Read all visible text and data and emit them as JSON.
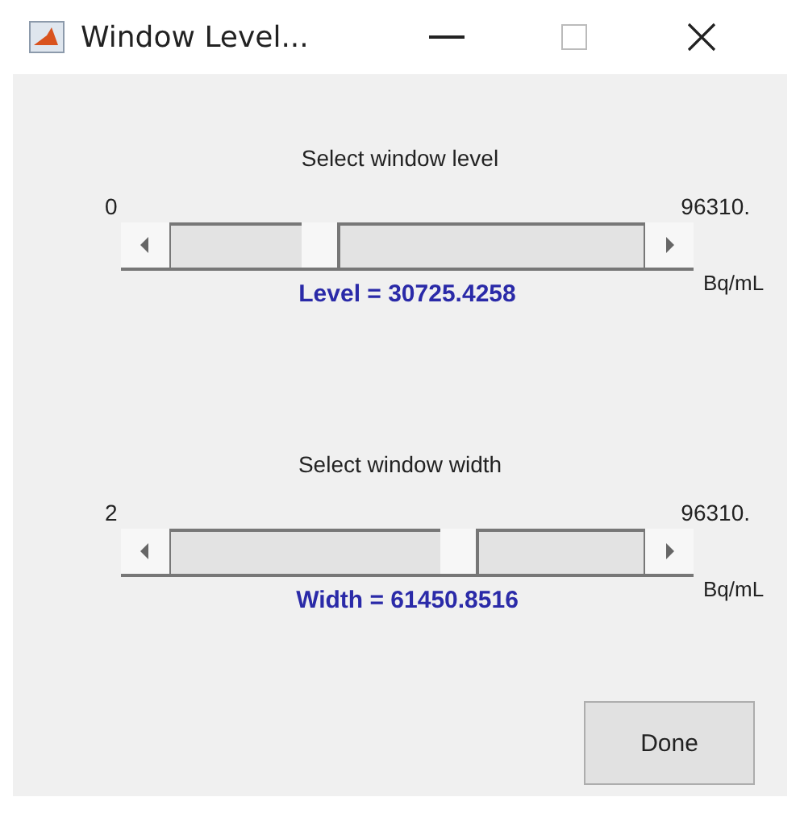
{
  "window": {
    "title": "Window Level..."
  },
  "sliders": [
    {
      "title": "Select window level",
      "min": "0",
      "max": "96310.",
      "level": 0.3,
      "reading": "Level = 30725.4258",
      "unit": "Bq/mL"
    },
    {
      "title": "Select window width",
      "min": "2",
      "max": "96310.",
      "level": 0.62,
      "reading": "Width = 61450.8516",
      "unit": "Bq/mL"
    }
  ],
  "buttons": [
    {
      "label": "Done"
    }
  ]
}
